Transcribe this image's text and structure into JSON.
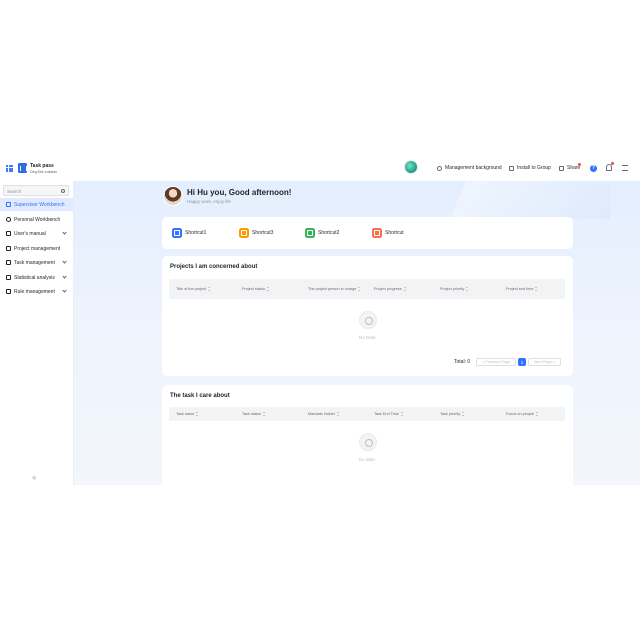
{
  "header": {
    "app_title": "Task pass",
    "app_subtitle": "DingTalk suitable",
    "management": "Management background",
    "install": "Install to Group",
    "share": "Share",
    "help": "?"
  },
  "sidebar": {
    "search_placeholder": "Search",
    "items": [
      {
        "label": "Supervisor Workbench",
        "active": true,
        "expandable": false
      },
      {
        "label": "Personal Workbench",
        "active": false,
        "expandable": false
      },
      {
        "label": "User's manual",
        "active": false,
        "expandable": true
      },
      {
        "label": "Project management",
        "active": false,
        "expandable": false
      },
      {
        "label": "Task management",
        "active": false,
        "expandable": true
      },
      {
        "label": "Statistical analysis",
        "active": false,
        "expandable": true
      },
      {
        "label": "Rule management",
        "active": false,
        "expandable": true
      }
    ],
    "collapse_label": "‹|›"
  },
  "profile": {
    "greeting": "Hi Hu you, Good afternoon!",
    "subtitle": "Happy work, enjoy life"
  },
  "shortcuts": [
    {
      "label": "Shortcut1",
      "color": "#3370ff"
    },
    {
      "label": "Shortcut3",
      "color": "#ff9900"
    },
    {
      "label": "Shortcut2",
      "color": "#34b35a"
    },
    {
      "label": "Shortcut",
      "color": "#f5704f"
    }
  ],
  "projects": {
    "title": "Projects I am concerned about",
    "columns": [
      "Title of the project",
      "Project status",
      "The project person in charge",
      "Project progress",
      "Project priority",
      "Project end time"
    ],
    "empty_text": "No Data",
    "total_label": "Total: 0",
    "prev_label": "< Previous Page",
    "page": "1",
    "next_label": "Next Page >"
  },
  "tasks": {
    "title": "The task I care about",
    "columns": [
      "Task name",
      "Task status",
      "Mandate Holder",
      "Task End Time",
      "Task priority",
      "Focus on people"
    ],
    "empty_text": "No data"
  }
}
